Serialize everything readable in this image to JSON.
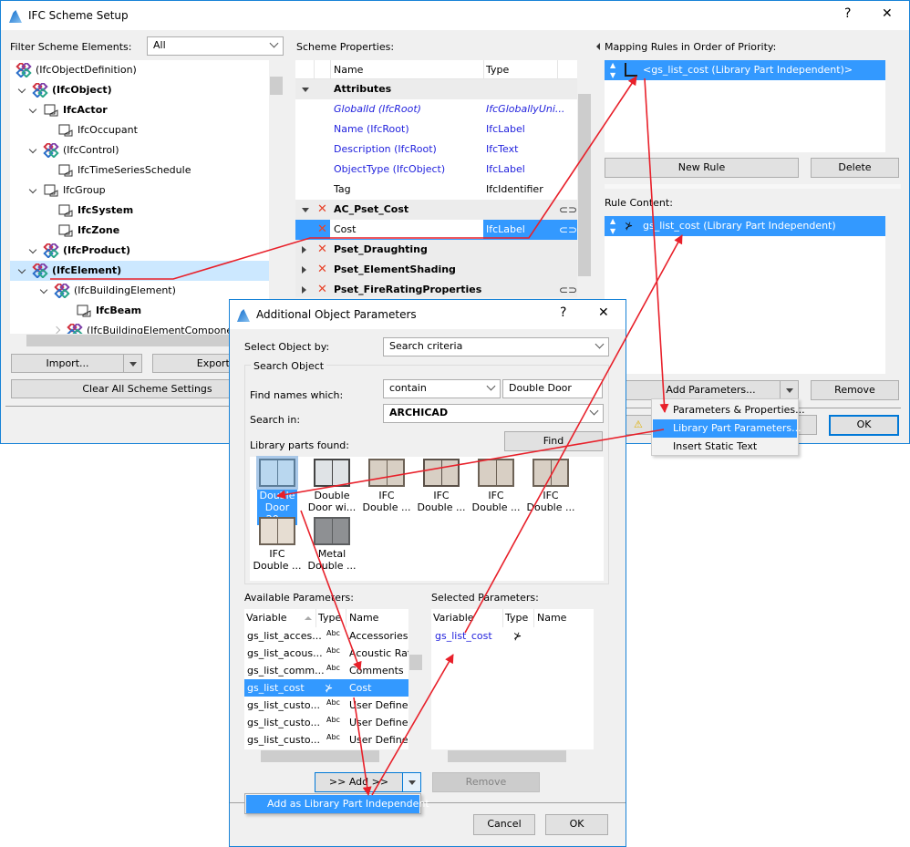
{
  "main_window": {
    "title": "IFC Scheme Setup",
    "help": "?",
    "close": "✕",
    "filter": {
      "label": "Filter Scheme Elements:",
      "value": "All"
    },
    "tree": [
      {
        "label": "(IfcObjectDefinition)",
        "icon": "ifc-logo-icon",
        "bold": false
      },
      {
        "label": "(IfcObject)",
        "icon": "ifc-logo-icon",
        "bold": true
      },
      {
        "label": "IfcActor",
        "icon": "actor-icon",
        "bold": true
      },
      {
        "label": "IfcOccupant",
        "icon": "occupant-icon",
        "bold": false
      },
      {
        "label": "(IfcControl)",
        "icon": "ifc-logo-icon",
        "bold": false
      },
      {
        "label": "IfcTimeSeriesSchedule",
        "icon": "schedule-icon",
        "bold": false
      },
      {
        "label": "IfcGroup",
        "icon": "group-icon",
        "bold": false
      },
      {
        "label": "IfcSystem",
        "icon": "system-icon",
        "bold": true
      },
      {
        "label": "IfcZone",
        "icon": "zone-icon",
        "bold": true
      },
      {
        "label": "(IfcProduct)",
        "icon": "ifc-logo-icon",
        "bold": true
      },
      {
        "label": "(IfcElement)",
        "icon": "ifc-logo-icon",
        "bold": true,
        "selected": true
      },
      {
        "label": "(IfcBuildingElement)",
        "icon": "ifc-logo-icon",
        "bold": false
      },
      {
        "label": "IfcBeam",
        "icon": "beam-icon",
        "bold": true
      },
      {
        "label": "(IfcBuildingElementComponent)",
        "icon": "ifc-logo-icon",
        "bold": false
      }
    ],
    "import_label": "Import...",
    "export_label": "Export...",
    "clear_label": "Clear All Scheme Settings",
    "scheme_properties": {
      "label": "Scheme Properties:",
      "columns": [
        "Name",
        "Type"
      ],
      "rows": [
        {
          "kind": "group",
          "name": "Attributes",
          "expanded": true
        },
        {
          "kind": "attr",
          "name": "GlobalId (IfcRoot)",
          "type": "IfcGloballyUni...",
          "style": "italic-blue"
        },
        {
          "kind": "attr",
          "name": "Name (IfcRoot)",
          "type": "IfcLabel",
          "style": "blue"
        },
        {
          "kind": "attr",
          "name": "Description (IfcRoot)",
          "type": "IfcText",
          "style": "blue"
        },
        {
          "kind": "attr",
          "name": "ObjectType (IfcObject)",
          "type": "IfcLabel",
          "style": "blue"
        },
        {
          "kind": "attr",
          "name": "Tag",
          "type": "IfcIdentifier",
          "style": "black"
        },
        {
          "kind": "group",
          "name": "AC_Pset_Cost",
          "expanded": true,
          "remove": true,
          "link": true
        },
        {
          "kind": "prop",
          "name": "Cost",
          "type": "IfcLabel",
          "remove": true,
          "link": true,
          "selected": true
        },
        {
          "kind": "group",
          "name": "Pset_Draughting",
          "expanded": false,
          "remove": true
        },
        {
          "kind": "group",
          "name": "Pset_ElementShading",
          "expanded": false,
          "remove": true
        },
        {
          "kind": "group",
          "name": "Pset_FireRatingProperties",
          "expanded": false,
          "remove": true,
          "link": true
        }
      ]
    },
    "mapping_rules": {
      "label": "Mapping Rules in Order of Priority:",
      "items": [
        "<gs_list_cost (Library Part Independent)>"
      ],
      "new_rule": "New Rule",
      "delete": "Delete"
    },
    "rule_content": {
      "label": "Rule Content:",
      "items": [
        "gs_list_cost (Library Part Independent)"
      ],
      "add_parameters": "Add Parameters...",
      "remove": "Remove"
    },
    "ok": "OK",
    "add_menu": [
      "Parameters & Properties...",
      "Library Part Parameters...",
      "Insert Static Text"
    ],
    "add_menu_highlight": 1
  },
  "dialog": {
    "title": "Additional Object Parameters",
    "help": "?",
    "close": "✕",
    "select_by": {
      "label": "Select Object by:",
      "value": "Search criteria"
    },
    "search_group": "Search Object",
    "find_names": {
      "label": "Find names which:",
      "mode": "contain",
      "text": "Double Door"
    },
    "search_in": {
      "label": "Search in:",
      "value": "ARCHICAD"
    },
    "found_label": "Library parts found:",
    "find_button": "Find",
    "library_parts": [
      {
        "l1": "Double",
        "l2": "Door 20...",
        "selected": true
      },
      {
        "l1": "Double",
        "l2": "Door wi..."
      },
      {
        "l1": "IFC",
        "l2": "Double ..."
      },
      {
        "l1": "IFC",
        "l2": "Double ..."
      },
      {
        "l1": "IFC",
        "l2": "Double ..."
      },
      {
        "l1": "IFC",
        "l2": "Double ..."
      },
      {
        "l1": "IFC",
        "l2": "Double ..."
      },
      {
        "l1": "Metal",
        "l2": "Double ..."
      }
    ],
    "available": {
      "label": "Available Parameters:",
      "columns": [
        "Variable",
        "Type",
        "Name"
      ],
      "rows": [
        {
          "variable": "gs_list_acces...",
          "type": "Abc",
          "name": "Accessories"
        },
        {
          "variable": "gs_list_acous...",
          "type": "Abc",
          "name": "Acoustic Rat"
        },
        {
          "variable": "gs_list_comm...",
          "type": "Abc",
          "name": "Comments"
        },
        {
          "variable": "gs_list_cost",
          "type": "length",
          "name": "Cost",
          "selected": true
        },
        {
          "variable": "gs_list_custo...",
          "type": "Abc",
          "name": "User Defined"
        },
        {
          "variable": "gs_list_custo...",
          "type": "Abc",
          "name": "User Defined"
        },
        {
          "variable": "gs_list_custo...",
          "type": "Abc",
          "name": "User Defined"
        }
      ]
    },
    "selected": {
      "label": "Selected Parameters:",
      "columns": [
        "Variable",
        "Type",
        "Name"
      ],
      "rows": [
        {
          "variable": "gs_list_cost",
          "type": "length",
          "name": ""
        }
      ]
    },
    "add_button": ">> Add >>",
    "remove_button": "Remove",
    "add_popup": "Add as Library Part Independent",
    "cancel": "Cancel",
    "ok": "OK"
  },
  "annotation_color": "#e8202a",
  "selection_color": "#3399ff"
}
